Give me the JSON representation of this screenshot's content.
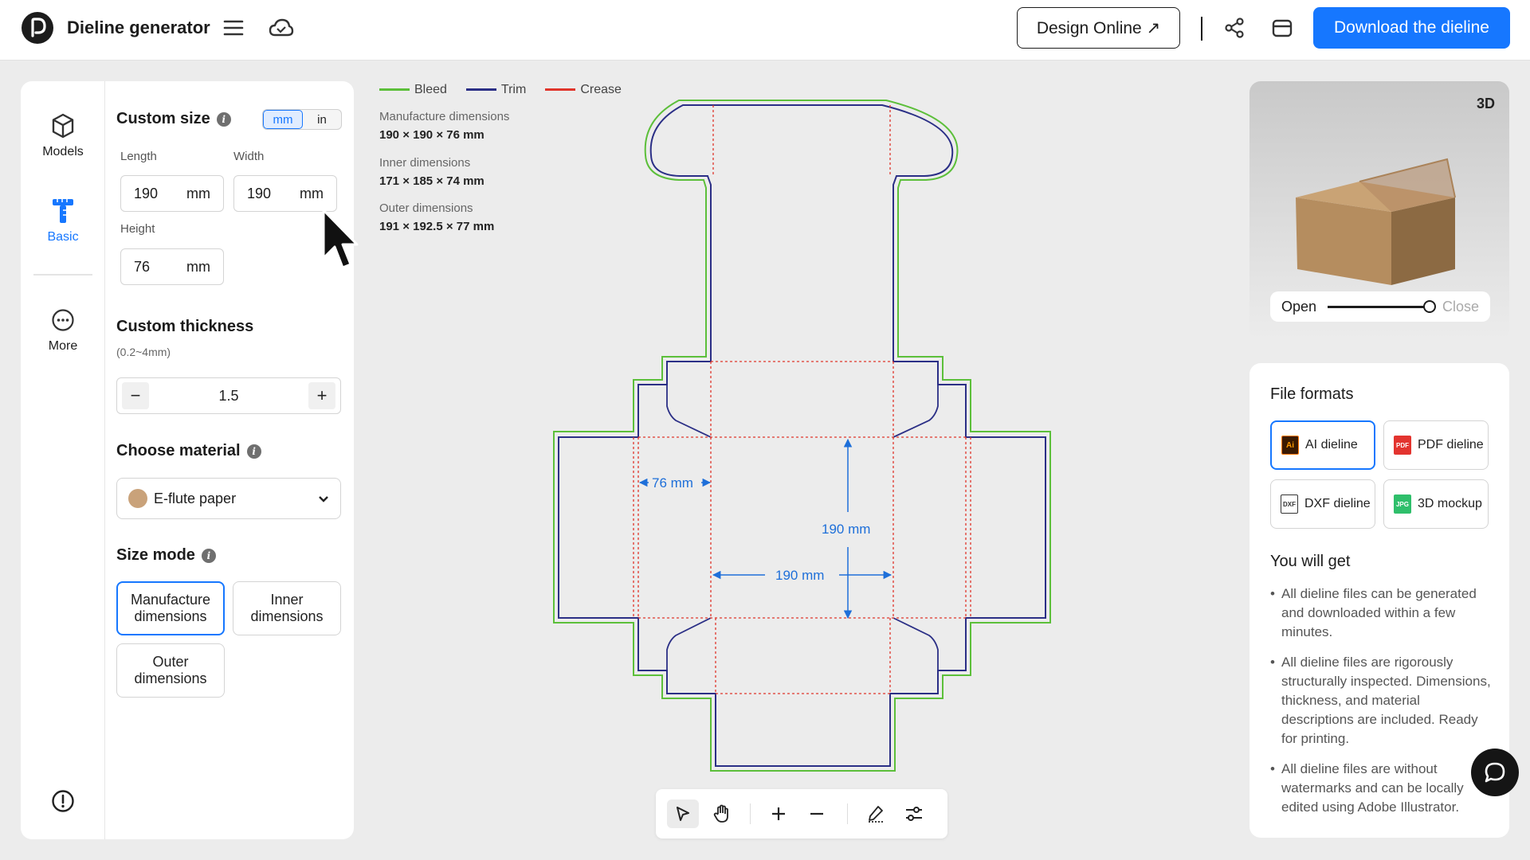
{
  "app": {
    "title": "Dieline generator"
  },
  "header": {
    "design_online_label": "Design Online ↗",
    "download_label": "Download the dieline"
  },
  "rail": {
    "items": [
      {
        "label": "Models",
        "icon": "cube-icon"
      },
      {
        "label": "Basic",
        "icon": "ruler-icon"
      },
      {
        "label": "More",
        "icon": "more-icon"
      }
    ]
  },
  "custom_size": {
    "title": "Custom size",
    "units": [
      "mm",
      "in"
    ],
    "selected_unit": "mm",
    "length": {
      "label": "Length",
      "value": "190",
      "unit": "mm"
    },
    "width": {
      "label": "Width",
      "value": "190",
      "unit": "mm"
    },
    "height": {
      "label": "Height",
      "value": "76",
      "unit": "mm"
    }
  },
  "thickness": {
    "title": "Custom thickness",
    "range": "(0.2~4mm)",
    "value": "1.5",
    "minus": "−",
    "plus": "+"
  },
  "material": {
    "title": "Choose material",
    "selected": "E-flute paper",
    "swatch": "#c9a27a"
  },
  "size_mode": {
    "title": "Size mode",
    "options": [
      "Manufacture dimensions",
      "Inner dimensions",
      "Outer dimensions"
    ],
    "selected": "Manufacture dimensions"
  },
  "legend": [
    {
      "label": "Bleed",
      "color": "#5cbf3a"
    },
    {
      "label": "Trim",
      "color": "#2b2f86"
    },
    {
      "label": "Crease",
      "color": "#e0352b"
    }
  ],
  "dimensions": [
    {
      "label": "Manufacture dimensions",
      "value": "190 × 190 × 76 mm"
    },
    {
      "label": "Inner dimensions",
      "value": "171 × 185 × 74 mm"
    },
    {
      "label": "Outer dimensions",
      "value": "191 × 192.5 × 77 mm"
    }
  ],
  "dieline_labels": {
    "height": "76 mm",
    "length": "190 mm",
    "width": "190 mm"
  },
  "preview": {
    "badge": "3D",
    "open_label": "Open",
    "close_label": "Close",
    "open_fraction": 1.0
  },
  "file_formats": {
    "title": "File formats",
    "items": [
      {
        "label": "AI dieline",
        "icon": "ai-file-icon",
        "tag": "Ai",
        "color": "#ff7a00"
      },
      {
        "label": "PDF dieline",
        "icon": "pdf-file-icon",
        "tag": "PDF",
        "color": "#e3342f"
      },
      {
        "label": "DXF dieline",
        "icon": "dxf-file-icon",
        "tag": "DXF",
        "color": "#333333"
      },
      {
        "label": "3D mockup",
        "icon": "jpg-file-icon",
        "tag": "JPG",
        "color": "#2fbf6b"
      }
    ],
    "selected": "AI dieline"
  },
  "you_will_get": {
    "title": "You will get",
    "bullets": [
      "All dieline files can be generated and downloaded within a few minutes.",
      "All dieline files are rigorously structurally inspected. Dimensions, thickness, and material descriptions are included. Ready for printing.",
      "All dieline files are without watermarks and can be locally edited using Adobe Illustrator."
    ]
  },
  "colors": {
    "accent": "#1677ff",
    "bleed": "#5cbf3a",
    "trim": "#2b2f86",
    "crease": "#e0352b",
    "dim": "#1e6fd9"
  }
}
